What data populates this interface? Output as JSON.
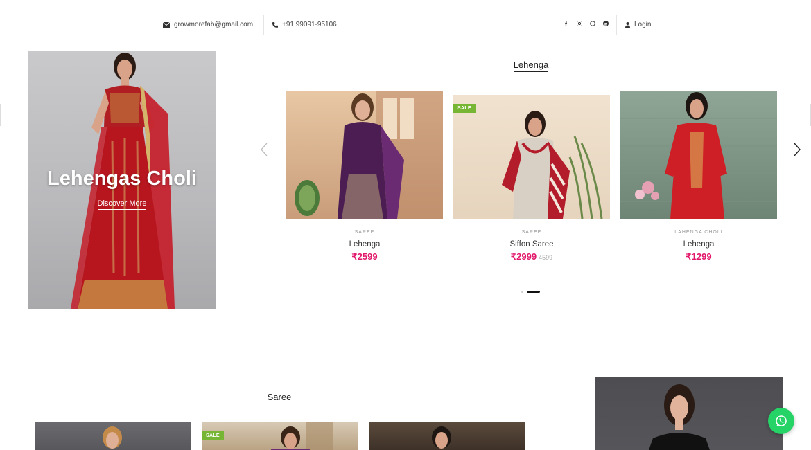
{
  "topbar": {
    "email": "growmorefab@gmail.com",
    "phone": "+91 99091-95106",
    "social": [
      "facebook-icon",
      "instagram-icon",
      "whatsapp-icon",
      "pinterest-icon"
    ],
    "login_label": "Login"
  },
  "banner": {
    "title": "Lehengas Choli",
    "link_label": "Discover More"
  },
  "lehenga_section": {
    "title": "Lehenga",
    "products": [
      {
        "category": "SAREE",
        "name": "Lehenga",
        "price": "₹2599",
        "old_price": "",
        "sale": false
      },
      {
        "category": "SAREE",
        "name": "Siffon Saree",
        "price": "₹2999",
        "old_price": "4599",
        "sale": true,
        "sale_label": "SALE"
      },
      {
        "category": "LAHENGA CHOLI",
        "name": "Lehenga",
        "price": "₹1299",
        "old_price": "",
        "sale": false
      }
    ],
    "carousel": {
      "pages": 2,
      "active": 2
    }
  },
  "saree_section": {
    "title": "Saree",
    "sale_label": "SALE"
  },
  "colors": {
    "price": "#e2186b",
    "sale_badge": "#77b534",
    "whatsapp": "#25d366"
  }
}
